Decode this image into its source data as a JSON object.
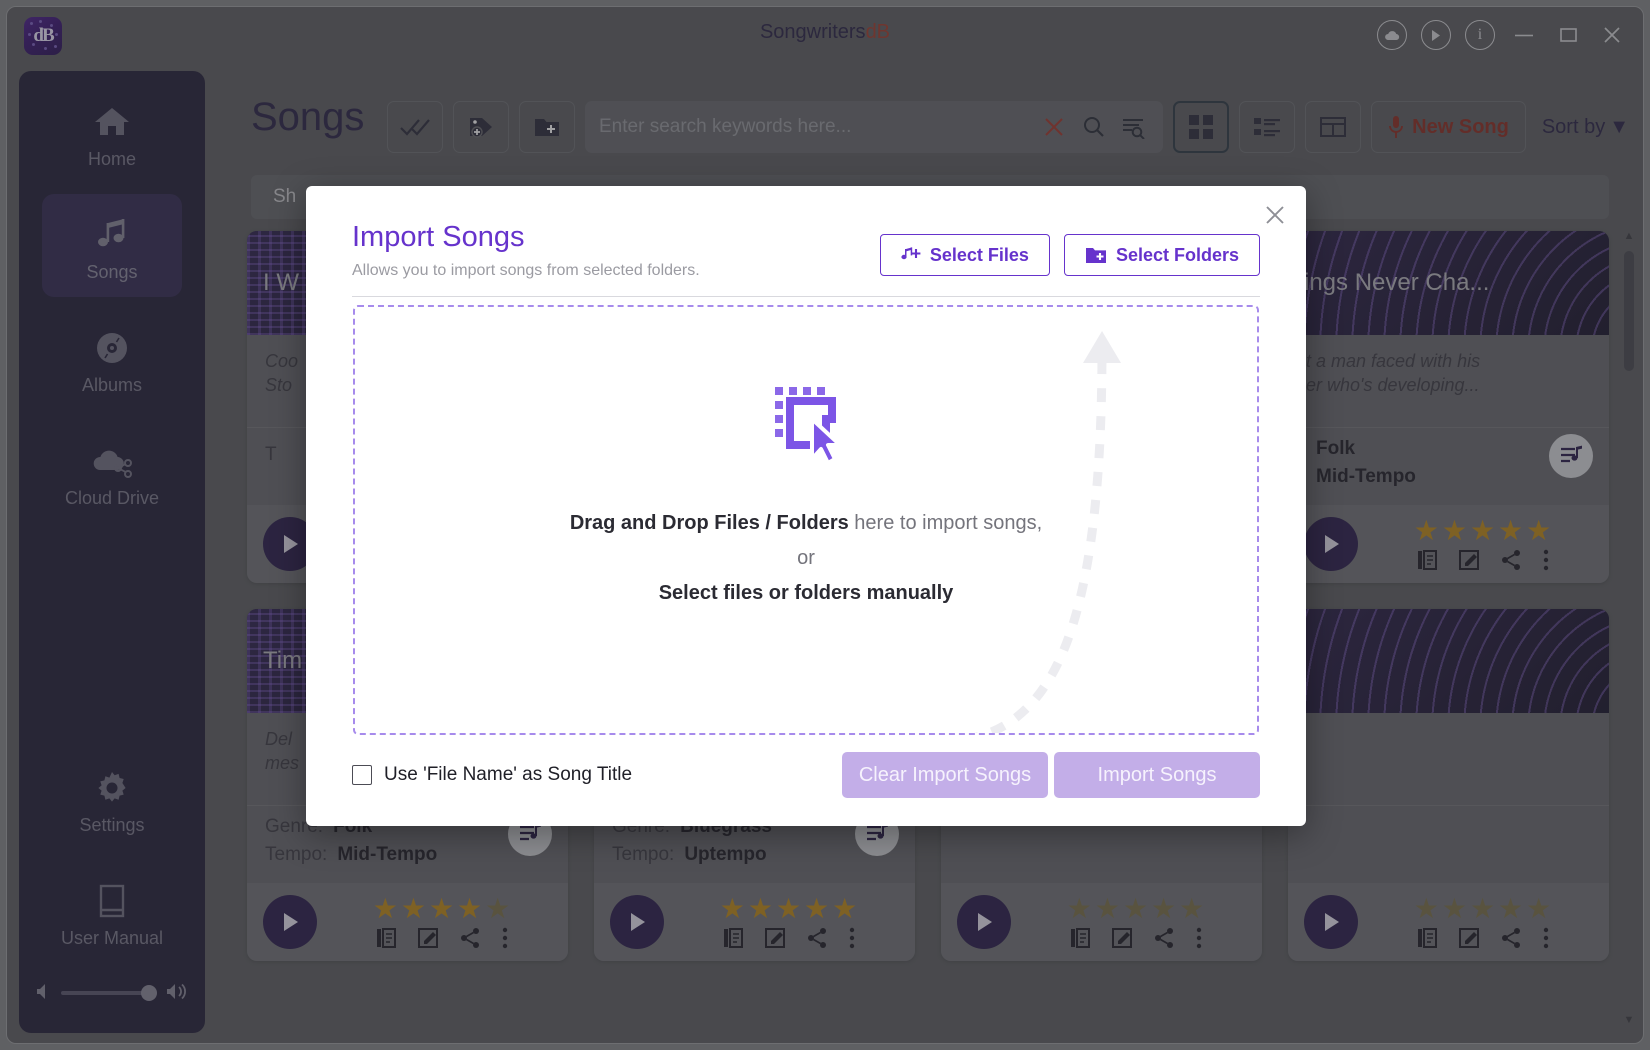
{
  "window": {
    "title_main": "Songwriters",
    "title_accent": "dB",
    "logo_text": "dB",
    "controls": {
      "cloud": "cloud-icon",
      "play": "play-circle-icon",
      "info": "info-icon",
      "minimize": "—",
      "maximize": "▢",
      "close": "✕"
    }
  },
  "sidebar": {
    "items": [
      {
        "label": "Home",
        "icon": "home-icon",
        "active": false
      },
      {
        "label": "Songs",
        "icon": "music-note-icon",
        "active": true
      },
      {
        "label": "Albums",
        "icon": "disc-icon",
        "active": false
      },
      {
        "label": "Cloud Drive",
        "icon": "cloud-share-icon",
        "active": false
      },
      {
        "label": "Settings",
        "icon": "gear-icon",
        "active": false
      },
      {
        "label": "User Manual",
        "icon": "book-icon",
        "active": false
      }
    ],
    "volume": {
      "level": 100,
      "mute_icon": "volume-low-icon",
      "max_icon": "volume-high-icon"
    }
  },
  "page": {
    "title": "Songs",
    "filter_bar_text": "Sh",
    "sort_label": "Sort by",
    "sort_caret": "▼",
    "new_song_label": "New Song"
  },
  "search": {
    "placeholder": "Enter search keywords here...",
    "value": "",
    "clear_icon": "clear-x-icon",
    "search_icon": "search-icon",
    "advanced_icon": "advanced-search-icon"
  },
  "toolbar_buttons": [
    {
      "name": "select-all-button",
      "icon": "double-check-icon"
    },
    {
      "name": "add-tag-button",
      "icon": "tag-plus-icon"
    },
    {
      "name": "new-folder-button",
      "icon": "folder-plus-icon"
    }
  ],
  "view_modes": [
    {
      "name": "grid-view-button",
      "icon": "grid-icon",
      "selected": true
    },
    {
      "name": "list-view-button",
      "icon": "list-icon",
      "selected": false
    },
    {
      "name": "table-view-button",
      "icon": "table-icon",
      "selected": false
    }
  ],
  "cards": [
    {
      "title": "I W",
      "desc": "Coo\nSto",
      "genre_key": "",
      "genre_val": "",
      "tempo_key": "T",
      "tempo_val": "",
      "rating": 0,
      "art": "weave"
    },
    {
      "title": "",
      "desc": "",
      "genre_key": "",
      "genre_val": "",
      "tempo_key": "",
      "tempo_val": "",
      "rating": 0,
      "art": "weave"
    },
    {
      "title": "",
      "desc": "",
      "genre_key": "",
      "genre_val": "",
      "tempo_key": "",
      "tempo_val": "",
      "rating": 0,
      "art": "weave"
    },
    {
      "title": "ings Never Cha...",
      "desc": "t a man faced with his\ner who's developing...",
      "genre_key": "",
      "genre_val": "Folk",
      "tempo_key": "",
      "tempo_val": "Mid-Tempo",
      "rating": 5,
      "art": "swirl"
    },
    {
      "title": "Tim",
      "desc": "Del\nmes",
      "genre_key": "Genre:",
      "genre_val": "Folk",
      "tempo_key": "Tempo:",
      "tempo_val": "Mid-Tempo",
      "rating": 4,
      "art": "weave"
    },
    {
      "title": "",
      "desc": "",
      "genre_key": "Genre:",
      "genre_val": "Bluegrass",
      "tempo_key": "Tempo:",
      "tempo_val": "Uptempo",
      "rating": 5,
      "art": "weave"
    },
    {
      "title": "",
      "desc": "",
      "genre_key": "",
      "genre_val": "",
      "tempo_key": "",
      "tempo_val": "",
      "rating": 0,
      "art": "weave"
    },
    {
      "title": "",
      "desc": "",
      "genre_key": "",
      "genre_val": "",
      "tempo_key": "",
      "tempo_val": "",
      "rating": 0,
      "art": "swirl"
    }
  ],
  "modal": {
    "title": "Import Songs",
    "subtitle": "Allows you to import songs from selected folders.",
    "close_icon": "close-icon",
    "select_files_label": "Select Files",
    "select_files_icon": "music-note-plus-icon",
    "select_folders_label": "Select Folders",
    "select_folders_icon": "folder-plus-icon",
    "dropzone": {
      "icon": "drag-select-cursor-icon",
      "line1_bold": "Drag and Drop Files / Folders",
      "line1_rest": " here to import songs,",
      "or": "or",
      "line2": "Select files or folders manually",
      "arrow_icon": "curved-dashed-arrow-icon"
    },
    "checkbox_label": "Use 'File Name' as Song Title",
    "checkbox_checked": false,
    "clear_button_label": "Clear Import Songs",
    "import_button_label": "Import Songs"
  },
  "colors": {
    "accent_purple": "#6633cc",
    "dropzone_border": "#a78bec",
    "disabled_button": "#c3aee8",
    "sidebar_bg": "#241f3a",
    "sidebar_active": "#342b55",
    "title_accent_red": "#a43d2d",
    "new_song_red": "#8e2d21",
    "star_gold": "#c08b18"
  },
  "scrollbar": {
    "up": "▲",
    "down": "▼"
  }
}
